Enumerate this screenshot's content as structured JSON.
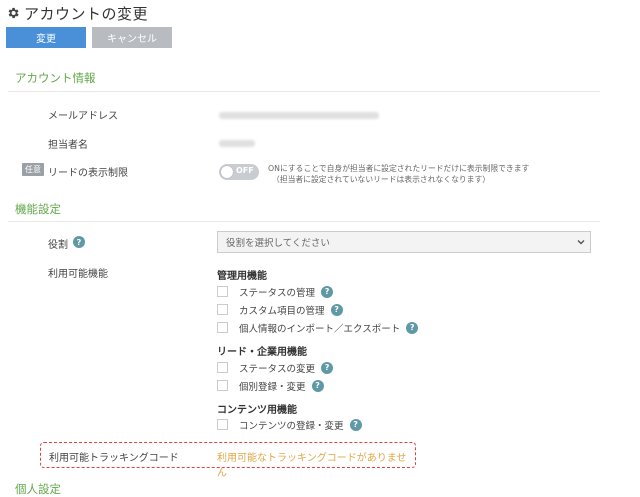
{
  "page": {
    "title": "アカウントの変更"
  },
  "actions": {
    "save_label": "変更",
    "cancel_label": "キャンセル"
  },
  "account_info": {
    "section_title": "アカウント情報",
    "email_label": "メールアドレス",
    "manager_label": "担当者名",
    "lead_restriction": {
      "badge": "任意",
      "label": "リードの表示制限",
      "toggle_state": "OFF",
      "note_line1": "ONにすることで自身が担当者に設定されたリードだけに表示制限できます",
      "note_line2": "（担当者に設定されていないリードは表示されなくなります）"
    }
  },
  "features": {
    "section_title": "機能設定",
    "role_label": "役割",
    "role_placeholder": "役割を選択してください",
    "available_label": "利用可能機能",
    "groups": [
      {
        "title": "管理用機能",
        "items": [
          "ステータスの管理",
          "カスタム項目の管理",
          "個人情報のインポート／エクスポート"
        ]
      },
      {
        "title": "リード・企業用機能",
        "items": [
          "ステータスの変更",
          "個別登録・変更"
        ]
      },
      {
        "title": "コンテンツ用機能",
        "items": [
          "コンテンツの登録・変更"
        ]
      }
    ],
    "tracking_label": "利用可能トラッキングコード",
    "tracking_message": "利用可能なトラッキングコードがありません"
  },
  "personal": {
    "section_title": "個人設定"
  },
  "colors": {
    "primary": "#4a90d9",
    "section": "#62a84a",
    "help": "#5f99a6",
    "warning": "#e0a848",
    "highlight": "#e04040"
  }
}
